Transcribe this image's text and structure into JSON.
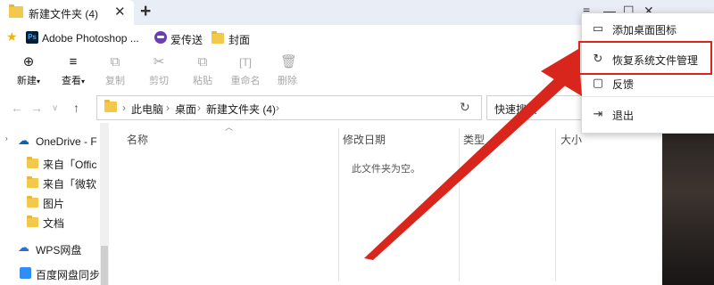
{
  "tab": {
    "title": "新建文件夹 (4)",
    "close": "✕",
    "new_tab": "+"
  },
  "window_controls": {
    "menu": "≡",
    "minimize": "—",
    "maximize": "☐",
    "close": "✕"
  },
  "bookmarks": [
    {
      "label": "Adobe Photoshop ...",
      "icon": "photoshop-icon",
      "icon_text": "Ps"
    },
    {
      "label": "爱传送",
      "icon": "aichuansong-icon"
    },
    {
      "label": "封面",
      "icon": "folder-icon"
    }
  ],
  "toolbar": {
    "new": "新建",
    "view": "查看",
    "copy": "复制",
    "cut": "剪切",
    "paste": "粘贴",
    "rename": "重命名",
    "delete": "删除"
  },
  "breadcrumbs": [
    "此电脑",
    "桌面",
    "新建文件夹 (4)"
  ],
  "search": {
    "placeholder": "快速搜索"
  },
  "sidebar": {
    "onedrive": "OneDrive - F",
    "items": [
      "来自「Offic",
      "来自「微软",
      "图片",
      "文档"
    ],
    "wps": "WPS网盘",
    "baidu": "百度网盘同步"
  },
  "columns": [
    "名称",
    "修改日期",
    "类型",
    "大小"
  ],
  "empty_message": "此文件夹为空。",
  "menu": {
    "items": [
      {
        "label": "添加桌面图标",
        "icon": "desktop-icon"
      },
      {
        "label": "恢复系统文件管理",
        "icon": "restore-icon"
      },
      {
        "label": "反馈",
        "icon": "feedback-icon"
      },
      {
        "label": "退出",
        "icon": "exit-icon"
      }
    ]
  },
  "colors": {
    "accent_red": "#d9261c",
    "folder_yellow": "#f4c84a"
  }
}
